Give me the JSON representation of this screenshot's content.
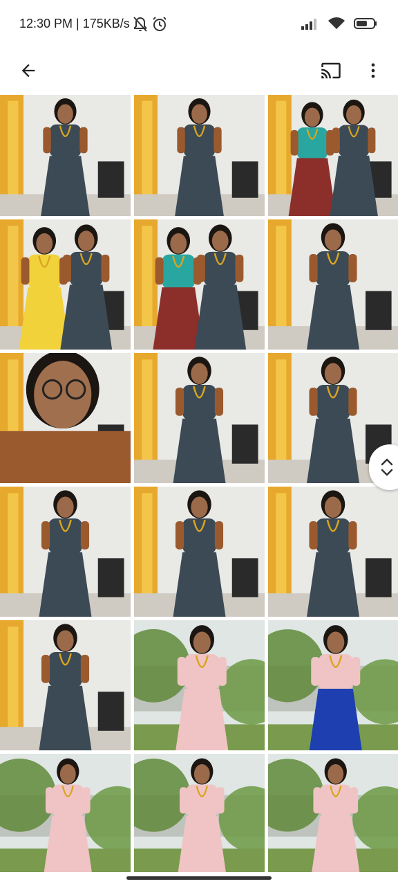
{
  "status_bar": {
    "time": "12:30 PM | 175KB/s",
    "icons": [
      "bell-muted-icon",
      "alarm-icon",
      "signal-icon",
      "wifi-icon",
      "battery-icon"
    ],
    "battery_level": 0.65
  },
  "app_bar": {
    "back_icon": "arrow-back-icon",
    "cast_icon": "cast-icon",
    "more_icon": "more-vert-icon"
  },
  "grid": {
    "photos": [
      {
        "scene": "indoor-saree"
      },
      {
        "scene": "indoor-saree-closeup"
      },
      {
        "scene": "indoor-two-girls"
      },
      {
        "scene": "selfie-two-girls"
      },
      {
        "scene": "indoor-two-girls"
      },
      {
        "scene": "indoor-saree"
      },
      {
        "scene": "selfie-glasses"
      },
      {
        "scene": "indoor-saree"
      },
      {
        "scene": "indoor-saree"
      },
      {
        "scene": "indoor-saree"
      },
      {
        "scene": "indoor-saree"
      },
      {
        "scene": "indoor-saree-door"
      },
      {
        "scene": "indoor-saree"
      },
      {
        "scene": "garden-pink-top"
      },
      {
        "scene": "garden-pink-top-blue-pants"
      },
      {
        "scene": "garden-profile"
      },
      {
        "scene": "garden-selfie-yellow"
      },
      {
        "scene": "garden-selfie-pink"
      }
    ]
  },
  "colors": {
    "background": "#ffffff",
    "icon": "#222222",
    "saree_dark": "#3c4a55",
    "saree_copper": "#9b5a2e",
    "door_orange": "#e6a21a",
    "wall": "#e9e9e6",
    "foliage": "#5f8a3a",
    "pink_top": "#f0c4c4"
  },
  "scroll_handle_icon": "drag-scroll-icon"
}
